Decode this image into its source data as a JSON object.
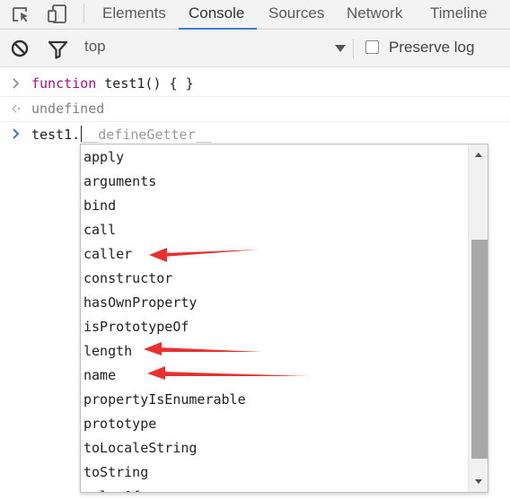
{
  "tabs": [
    {
      "label": "Elements"
    },
    {
      "label": "Console"
    },
    {
      "label": "Sources"
    },
    {
      "label": "Network"
    },
    {
      "label": "Timeline"
    }
  ],
  "active_tab": "Console",
  "toolbar": {
    "context": "top",
    "preserve_log_label": "Preserve log",
    "preserve_log_checked": false
  },
  "console": {
    "input1": {
      "keyword": "function",
      "rest": " test1() { }"
    },
    "output1": "undefined",
    "current_input": "test1.",
    "ghost_completion": "__defineGetter__"
  },
  "suggestions": [
    "apply",
    "arguments",
    "bind",
    "call",
    "caller",
    "constructor",
    "hasOwnProperty",
    "isPrototypeOf",
    "length",
    "name",
    "propertyIsEnumerable",
    "prototype",
    "toLocaleString",
    "toString",
    "valueOf"
  ],
  "annotation_color": "#e8312f",
  "accent_color": "#3879d9",
  "keyword_color": "#aa0d91"
}
